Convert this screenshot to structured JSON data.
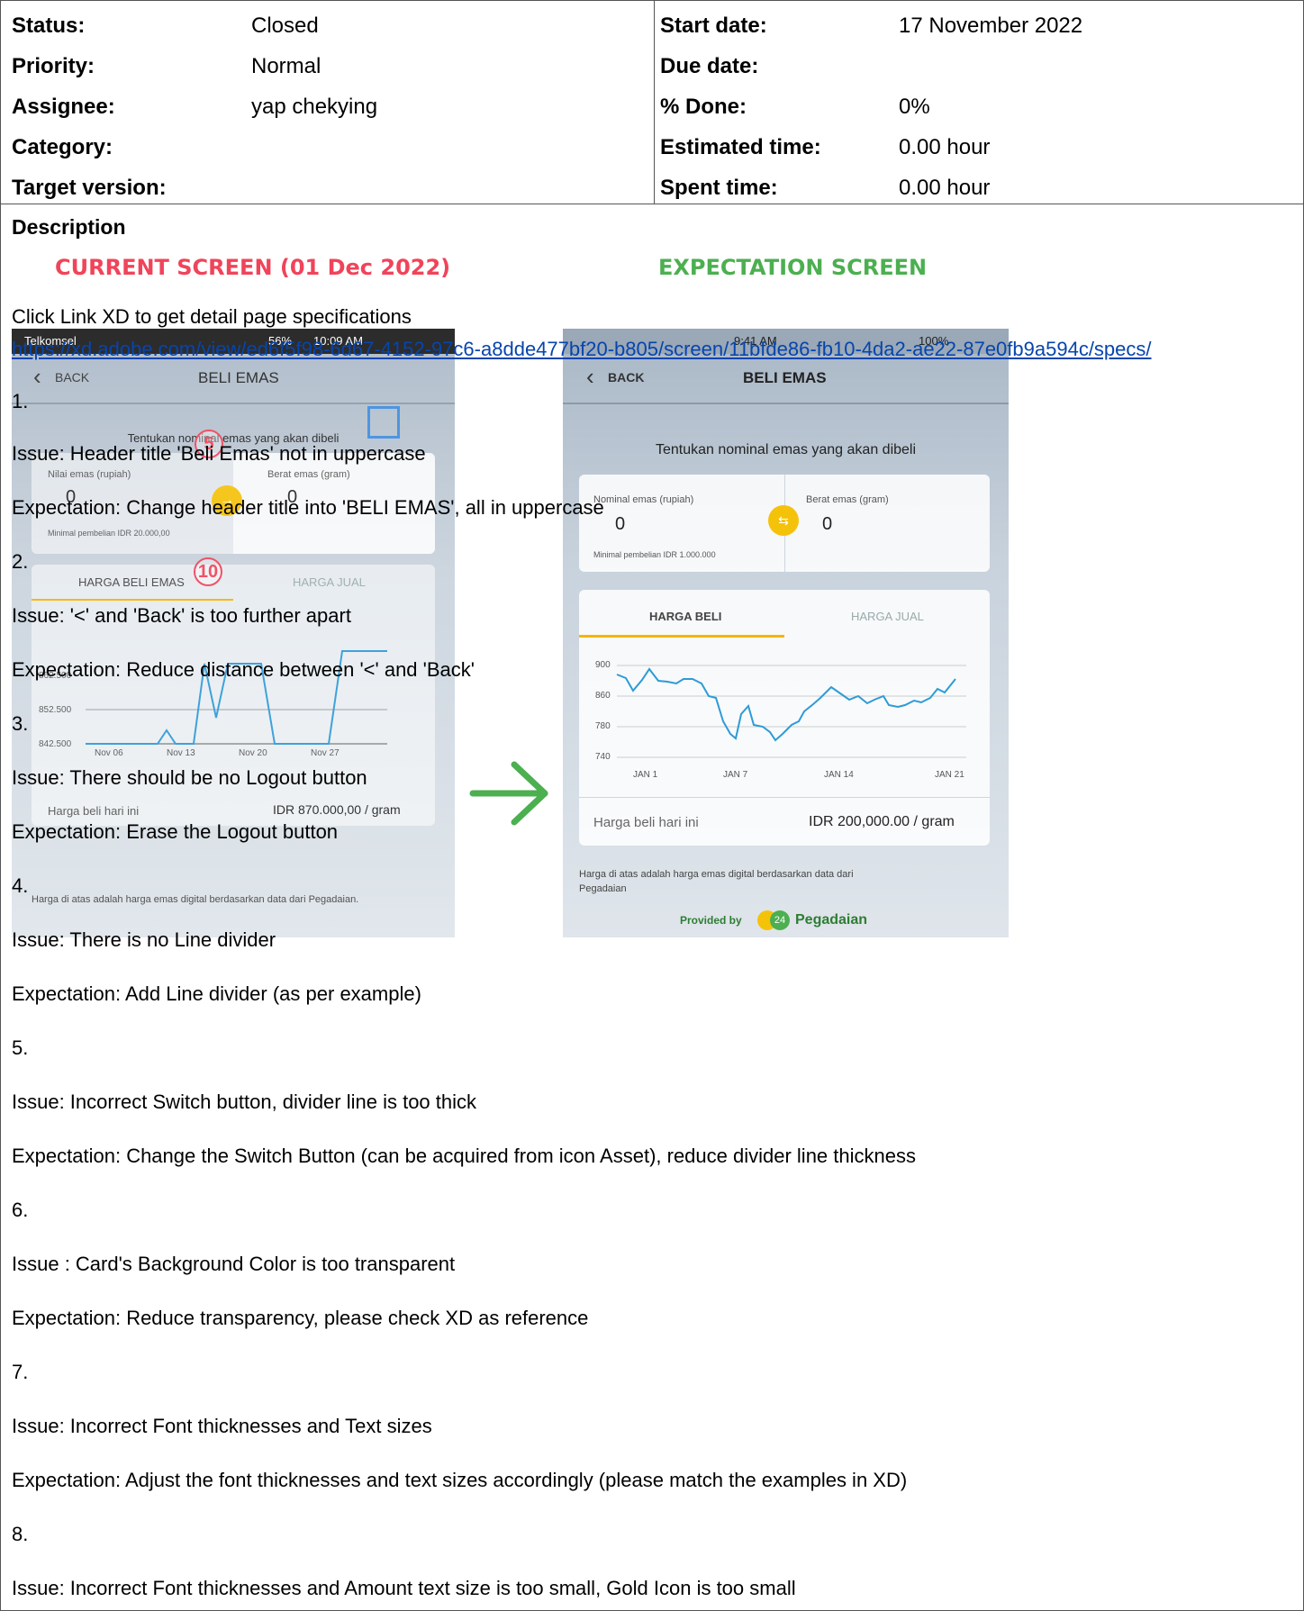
{
  "attributes": {
    "status_label": "Status:",
    "status_value": "Closed",
    "priority_label": "Priority:",
    "priority_value": "Normal",
    "assignee_label": "Assignee:",
    "assignee_value": "yap chekying",
    "category_label": "Category:",
    "target_label": "Target version:",
    "start_label": "Start date:",
    "start_value": "17 November 2022",
    "due_label": "Due date:",
    "done_label": "% Done:",
    "done_value": "0%",
    "estimated_label": "Estimated time:",
    "estimated_value": "0.00 hour",
    "spent_label": "Spent time:",
    "spent_value": "0.00 hour"
  },
  "description": {
    "heading": "Description",
    "current_title": "CURRENT SCREEN (01 Dec 2022)",
    "expectation_title": "EXPECTATION SCREEN",
    "link_intro": "Click Link XD to get detail page specifications",
    "link_text": "https://xd.adobe.com/view/ed6f5f98-6d67-4152-97c6-a8dde477bf20-b805/screen/11bfde86-fb10-4da2-ae22-87e0fb9a594c/specs/"
  },
  "current_screen": {
    "carrier": "Telkomsel",
    "battery": "56%",
    "clock": "10:09 AM",
    "back": "BACK",
    "title": "BELI EMAS",
    "subtitle": "Tentukan nominal emas yang akan dibeli",
    "nominal_label": "Nilai emas (rupiah)",
    "nominal_value": "0",
    "weight_label": "Berat emas (gram)",
    "weight_value": "0",
    "minimum": "Minimal pembelian IDR 20.000,00",
    "tab_buy": "HARGA BELI EMAS",
    "tab_sell": "HARGA JUAL",
    "y_ticks": [
      "862.500",
      "852.500",
      "842.500"
    ],
    "x_ticks": [
      "Nov 06",
      "Nov 13",
      "Nov 20",
      "Nov 27"
    ],
    "price_label": "Harga beli hari ini",
    "price_value": "IDR 870.000,00 / gram",
    "footnote": "Harga di atas adalah harga emas digital berdasarkan data dari Pegadaian.",
    "marker_5": "5",
    "marker_10": "10"
  },
  "expected_screen": {
    "battery": "100%",
    "clock": "9:41 AM",
    "back": "BACK",
    "title": "BELI EMAS",
    "subtitle": "Tentukan nominal emas yang akan dibeli",
    "nominal_label": "Nominal emas (rupiah)",
    "nominal_value": "0",
    "weight_label": "Berat emas (gram)",
    "weight_value": "0",
    "minimum": "Minimal pembelian IDR 1.000.000",
    "tab_buy": "HARGA BELI",
    "tab_sell": "HARGA JUAL",
    "y_ticks": [
      "900",
      "860",
      "780",
      "740"
    ],
    "x_ticks": [
      "JAN 1",
      "JAN 7",
      "JAN 14",
      "JAN 21"
    ],
    "price_label": "Harga beli hari ini",
    "price_value": "IDR 200,000.00 / gram",
    "footnote_1": "Harga di atas adalah harga emas digital berdasarkan data dari",
    "footnote_2": "Pegadaian",
    "provided_by": "Provided by",
    "brand": "Pegadaian",
    "brand_badge": "24"
  },
  "issues": [
    {
      "number": "1.",
      "issue": "Issue: Header title 'Beli Emas' not in uppercase",
      "expectation": "Expectation: Change header title into 'BELI EMAS', all in uppercase"
    },
    {
      "number": "2.",
      "issue": "Issue: '<' and 'Back' is too further apart",
      "expectation": "Expectation: Reduce distance between '<' and 'Back'"
    },
    {
      "number": "3.",
      "issue": "Issue: There should be no Logout button",
      "expectation": "Expectation: Erase the Logout button"
    },
    {
      "number": "4.",
      "issue": "Issue: There is no Line divider",
      "expectation": "Expectation: Add Line divider (as per example)"
    },
    {
      "number": "5.",
      "issue": "Issue: Incorrect Switch button, divider line is too thick",
      "expectation": "Expectation: Change the Switch Button (can be acquired from icon Asset), reduce divider line thickness"
    },
    {
      "number": "6.",
      "issue": "Issue : Card's Background Color is too transparent",
      "expectation": "Expectation: Reduce transparency, please check XD as reference"
    },
    {
      "number": "7.",
      "issue": "Issue: Incorrect Font thicknesses and Text sizes",
      "expectation": "Expectation: Adjust the font thicknesses and text sizes accordingly (please match the examples in XD)"
    },
    {
      "number": "8.",
      "issue": "Issue: Incorrect Font thicknesses and Amount text size is too small, Gold Icon is too small"
    }
  ],
  "colors": {
    "current_title": "#f0445a",
    "expectation_title": "#4caf50",
    "link": "#0645ad",
    "chart_line": "#2e9bd6",
    "accent": "#f5c20a"
  }
}
